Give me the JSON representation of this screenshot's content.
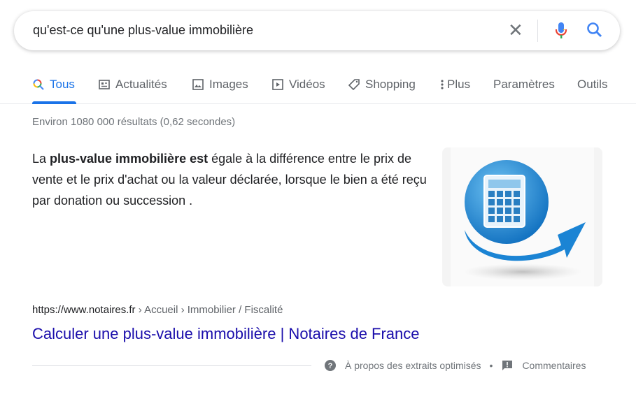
{
  "search": {
    "query": "qu'est-ce qu'une plus-value immobilière",
    "clear_icon": "close-icon",
    "mic_icon": "mic-icon",
    "search_icon": "search-icon"
  },
  "tabs": [
    {
      "label": "Tous",
      "icon": "search-icon",
      "active": true
    },
    {
      "label": "Actualités",
      "icon": "news-icon"
    },
    {
      "label": "Images",
      "icon": "image-icon"
    },
    {
      "label": "Vidéos",
      "icon": "video-icon"
    },
    {
      "label": "Shopping",
      "icon": "tag-icon"
    },
    {
      "label": "Plus",
      "icon": "more-vert-icon"
    },
    {
      "label": "Paramètres"
    },
    {
      "label": "Outils"
    }
  ],
  "result_stats": "Environ 1080 000 résultats (0,62 secondes)",
  "snippet": {
    "pre": "La ",
    "bold": "plus-value immobilière est",
    "post": " égale à la différence entre le prix de vente et le prix d'achat ou la valeur déclarée, lorsque le bien a été reçu par donation ou succession ."
  },
  "result": {
    "domain": "https://www.notaires.fr",
    "path": " › Accueil › Immobilier / Fiscalité",
    "title": "Calculer une plus-value immobilière | Notaires de France"
  },
  "footer": {
    "about": "À propos des extraits optimisés",
    "separator": "•",
    "feedback": "Commentaires"
  },
  "colors": {
    "accent": "#1a73e8",
    "link": "#1a0dab"
  }
}
